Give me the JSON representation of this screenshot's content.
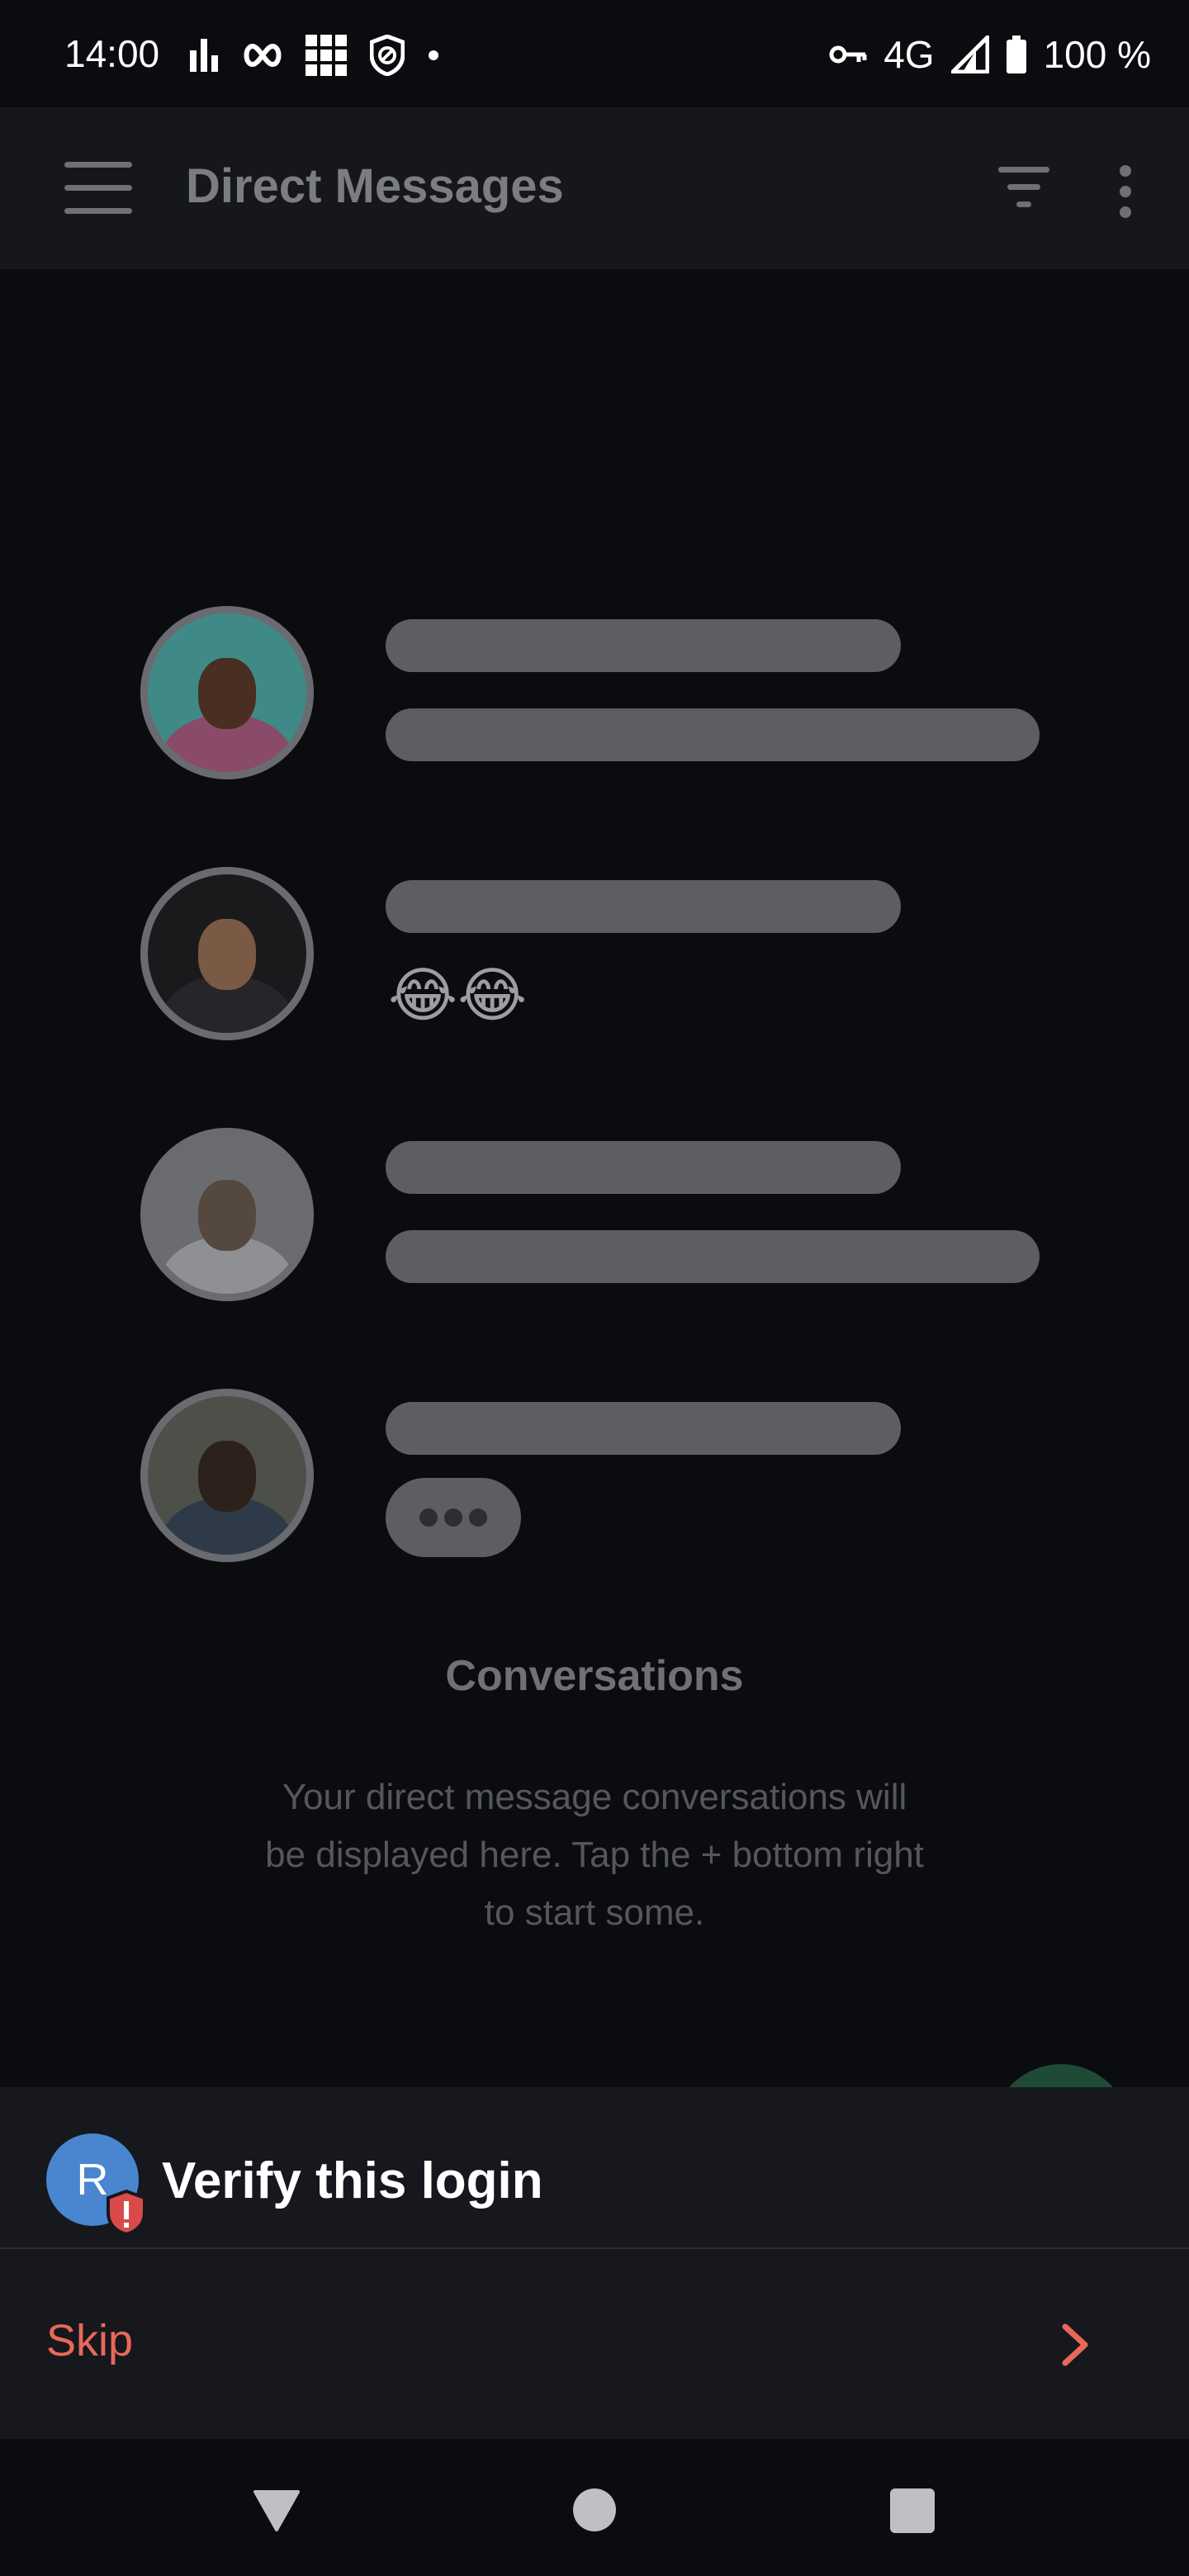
{
  "status_bar": {
    "time": "14:00",
    "network": "4G",
    "battery": "100 %",
    "left_icons": [
      "signal-bars-icon",
      "infinity-icon",
      "grid-icon",
      "shield-icon",
      "dot-icon"
    ],
    "right_icons": [
      "key-icon",
      "cell-signal-icon",
      "battery-icon"
    ]
  },
  "app_bar": {
    "title": "Direct Messages",
    "icons": [
      "menu-icon",
      "filter-icon",
      "more-vert-icon"
    ]
  },
  "empty_state": {
    "title": "Conversations",
    "description": "Your direct message conversations will be displayed here. Tap the + bottom right to start some.",
    "preview_rows": [
      {
        "type": "two-bars"
      },
      {
        "type": "emoji",
        "emoji": "😂😂"
      },
      {
        "type": "two-bars"
      },
      {
        "type": "typing"
      }
    ]
  },
  "sheet": {
    "avatar_letter": "R",
    "title": "Verify this login",
    "skip_label": "Skip",
    "colors": {
      "accent": "#e8685a",
      "avatar": "#4a86cf",
      "badge": "#d94a4a"
    }
  },
  "nav": {
    "icons": [
      "back-triangle-icon",
      "home-circle-icon",
      "recents-square-icon"
    ]
  }
}
